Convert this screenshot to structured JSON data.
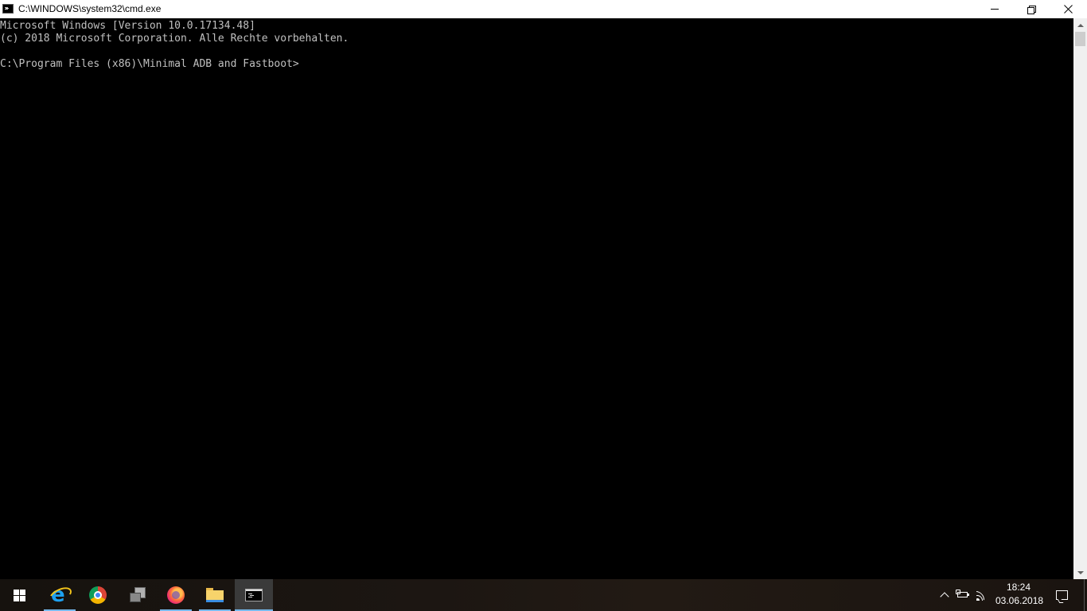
{
  "window": {
    "title": "C:\\WINDOWS\\system32\\cmd.exe",
    "icon": "cmd-icon",
    "controls": [
      "minimize",
      "restore",
      "close"
    ]
  },
  "console": {
    "lines": [
      "Microsoft Windows [Version 10.0.17134.48]",
      "(c) 2018 Microsoft Corporation. Alle Rechte vorbehalten.",
      "",
      "C:\\Program Files (x86)\\Minimal ADB and Fastboot>"
    ],
    "text_color": "#c0c0c0",
    "background": "#000000"
  },
  "taskbar": {
    "accent": "#76b9ed",
    "items": [
      {
        "name": "start",
        "icon": "windows-logo-icon"
      },
      {
        "name": "internet-explorer",
        "icon": "internet-explorer-icon",
        "running": true
      },
      {
        "name": "chrome",
        "icon": "chrome-icon",
        "running": false
      },
      {
        "name": "app",
        "icon": "application-icon",
        "running": false
      },
      {
        "name": "firefox",
        "icon": "firefox-icon",
        "running": true
      },
      {
        "name": "file-explorer",
        "icon": "folder-icon",
        "running": true
      },
      {
        "name": "command-prompt",
        "icon": "cmd-icon",
        "running": true,
        "active": true
      }
    ],
    "tray": {
      "time": "18:24",
      "date": "03.06.2018"
    }
  }
}
